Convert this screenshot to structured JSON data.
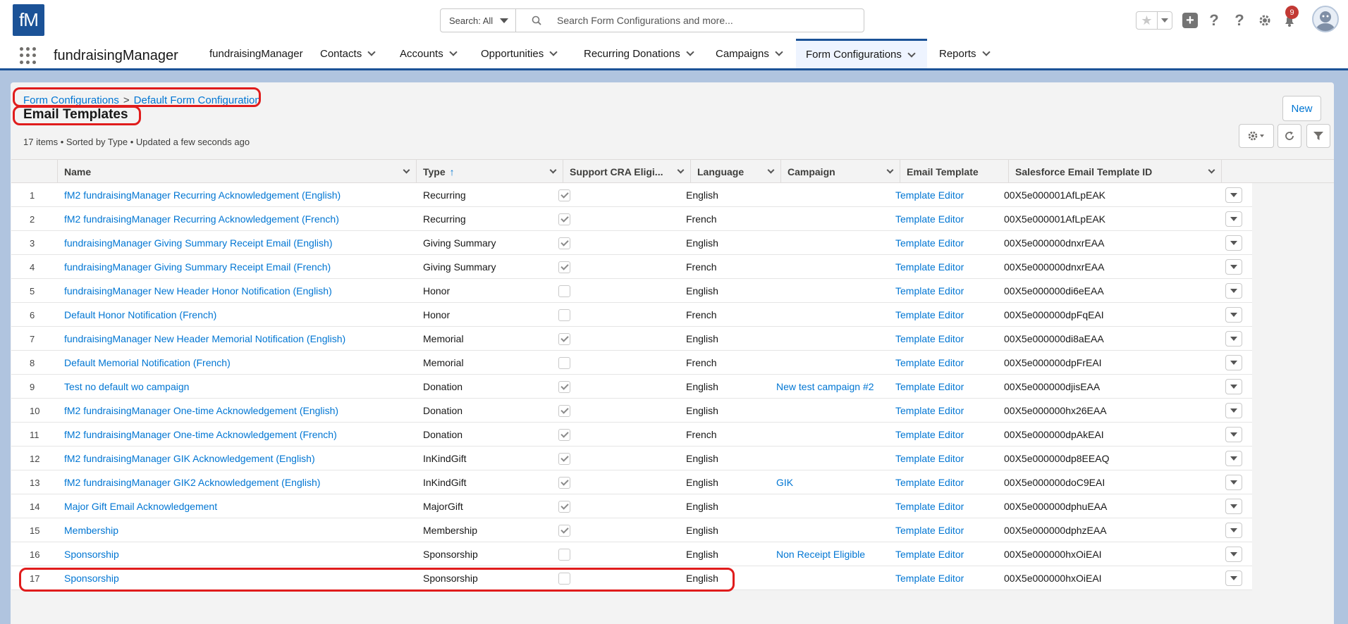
{
  "header": {
    "logo_text": "fM",
    "search_scope": "Search: All",
    "search_placeholder": "Search Form Configurations and more...",
    "notification_count": "9"
  },
  "nav": {
    "app_name": "fundraisingManager",
    "tabs": [
      {
        "label": "fundraisingManager",
        "has_menu": false
      },
      {
        "label": "Contacts",
        "has_menu": true
      },
      {
        "label": "Accounts",
        "has_menu": true
      },
      {
        "label": "Opportunities",
        "has_menu": true
      },
      {
        "label": "Recurring Donations",
        "has_menu": true
      },
      {
        "label": "Campaigns",
        "has_menu": true
      },
      {
        "label": "Form Configurations",
        "has_menu": true,
        "active": true
      },
      {
        "label": "Reports",
        "has_menu": true
      }
    ]
  },
  "page": {
    "breadcrumb_1": "Form Configurations",
    "breadcrumb_sep": ">",
    "breadcrumb_2": "Default Form Configuration",
    "title": "Email Templates",
    "meta": "17 items • Sorted by Type • Updated a few seconds ago",
    "new_button": "New"
  },
  "table": {
    "columns": [
      "Name",
      "Type",
      "Support CRA Eligi...",
      "Language",
      "Campaign",
      "Email Template",
      "Salesforce Email Template ID"
    ],
    "sort_indicator": "↑",
    "rows": [
      {
        "num": "1",
        "name": "fM2 fundraisingManager Recurring Acknowledgement (English)",
        "type": "Recurring",
        "cra": true,
        "language": "English",
        "campaign": "",
        "template": "Template Editor",
        "sf_id": "00X5e000001AfLpEAK"
      },
      {
        "num": "2",
        "name": "fM2 fundraisingManager Recurring Acknowledgement (French)",
        "type": "Recurring",
        "cra": true,
        "language": "French",
        "campaign": "",
        "template": "Template Editor",
        "sf_id": "00X5e000001AfLpEAK"
      },
      {
        "num": "3",
        "name": "fundraisingManager Giving Summary Receipt Email (English)",
        "type": "Giving Summary",
        "cra": true,
        "language": "English",
        "campaign": "",
        "template": "Template Editor",
        "sf_id": "00X5e000000dnxrEAA"
      },
      {
        "num": "4",
        "name": "fundraisingManager Giving Summary Receipt Email (French)",
        "type": "Giving Summary",
        "cra": true,
        "language": "French",
        "campaign": "",
        "template": "Template Editor",
        "sf_id": "00X5e000000dnxrEAA"
      },
      {
        "num": "5",
        "name": "fundraisingManager New Header Honor Notification (English)",
        "type": "Honor",
        "cra": false,
        "language": "English",
        "campaign": "",
        "template": "Template Editor",
        "sf_id": "00X5e000000di6eEAA"
      },
      {
        "num": "6",
        "name": "Default Honor Notification (French)",
        "type": "Honor",
        "cra": false,
        "language": "French",
        "campaign": "",
        "template": "Template Editor",
        "sf_id": "00X5e000000dpFqEAI"
      },
      {
        "num": "7",
        "name": "fundraisingManager New Header Memorial Notification (English)",
        "type": "Memorial",
        "cra": true,
        "language": "English",
        "campaign": "",
        "template": "Template Editor",
        "sf_id": "00X5e000000di8aEAA"
      },
      {
        "num": "8",
        "name": "Default Memorial Notification (French)",
        "type": "Memorial",
        "cra": false,
        "language": "French",
        "campaign": "",
        "template": "Template Editor",
        "sf_id": "00X5e000000dpFrEAI"
      },
      {
        "num": "9",
        "name": "Test no default wo campaign",
        "type": "Donation",
        "cra": true,
        "language": "English",
        "campaign": "New test campaign #2",
        "template": "Template Editor",
        "sf_id": "00X5e000000djisEAA"
      },
      {
        "num": "10",
        "name": "fM2 fundraisingManager One-time Acknowledgement (English)",
        "type": "Donation",
        "cra": true,
        "language": "English",
        "campaign": "",
        "template": "Template Editor",
        "sf_id": "00X5e000000hx26EAA"
      },
      {
        "num": "11",
        "name": "fM2 fundraisingManager One-time Acknowledgement (French)",
        "type": "Donation",
        "cra": true,
        "language": "French",
        "campaign": "",
        "template": "Template Editor",
        "sf_id": "00X5e000000dpAkEAI"
      },
      {
        "num": "12",
        "name": "fM2 fundraisingManager GIK Acknowledgement (English)",
        "type": "InKindGift",
        "cra": true,
        "language": "English",
        "campaign": "",
        "template": "Template Editor",
        "sf_id": "00X5e000000dp8EEAQ"
      },
      {
        "num": "13",
        "name": "fM2 fundraisingManager GIK2 Acknowledgement (English)",
        "type": "InKindGift",
        "cra": true,
        "language": "English",
        "campaign": "GIK",
        "template": "Template Editor",
        "sf_id": "00X5e000000doC9EAI"
      },
      {
        "num": "14",
        "name": "Major Gift Email Acknowledgement",
        "type": "MajorGift",
        "cra": true,
        "language": "English",
        "campaign": "",
        "template": "Template Editor",
        "sf_id": "00X5e000000dphuEAA"
      },
      {
        "num": "15",
        "name": "Membership",
        "type": "Membership",
        "cra": true,
        "language": "English",
        "campaign": "",
        "template": "Template Editor",
        "sf_id": "00X5e000000dphzEAA"
      },
      {
        "num": "16",
        "name": "Sponsorship",
        "type": "Sponsorship",
        "cra": false,
        "language": "English",
        "campaign": "Non Receipt Eligible",
        "template": "Template Editor",
        "sf_id": "00X5e000000hxOiEAI"
      },
      {
        "num": "17",
        "name": "Sponsorship",
        "type": "Sponsorship",
        "cra": false,
        "language": "English",
        "campaign": "",
        "template": "Template Editor",
        "sf_id": "00X5e000000hxOiEAI"
      }
    ]
  }
}
